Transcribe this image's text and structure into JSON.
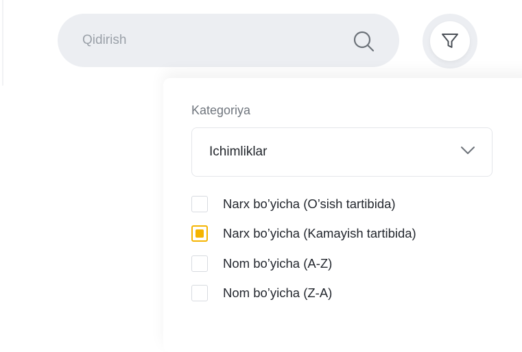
{
  "search": {
    "placeholder": "Qidirish",
    "icon": "search-icon"
  },
  "filter_button": {
    "icon": "filter-icon"
  },
  "filter_panel": {
    "category_label": "Kategoriya",
    "category_value": "Ichimliklar",
    "sort_options": [
      {
        "label": "Narx bo’yicha (O’sish tartibida)",
        "checked": false
      },
      {
        "label": "Narx bo’yicha (Kamayish tartibida)",
        "checked": true
      },
      {
        "label": "Nom bo’yicha (A-Z)",
        "checked": false
      },
      {
        "label": "Nom bo’yicha (Z-A)",
        "checked": false
      }
    ]
  },
  "colors": {
    "accent": "#f5b400",
    "search_bg": "#eceef2",
    "text_primary": "#23272e",
    "text_muted": "#6f757d"
  }
}
